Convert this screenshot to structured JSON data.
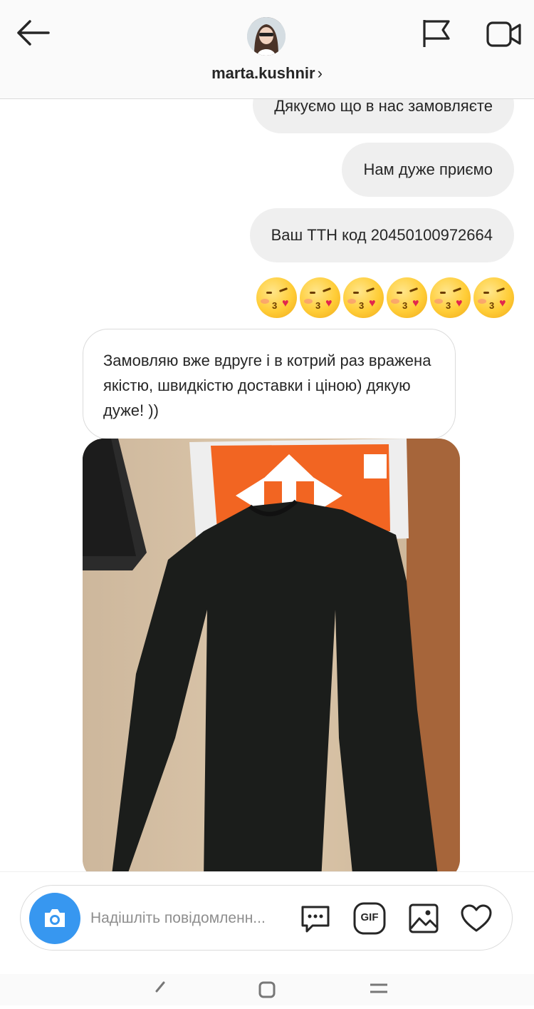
{
  "header": {
    "username": "marta.kushnir",
    "chevron": "›",
    "icons": [
      "back-arrow-icon",
      "flag-icon",
      "video-call-icon"
    ]
  },
  "messages": [
    {
      "side": "right",
      "text": "Дякуємо що в нас замовляєте"
    },
    {
      "side": "right",
      "text": "Нам дуже приємо"
    },
    {
      "side": "right",
      "text": "Ваш ТТН код 20450100972664"
    },
    {
      "side": "right",
      "emoji": "😘",
      "count": 6
    },
    {
      "side": "left",
      "text": "Замовляю вже вдруге і в котрий раз вражена якістю,  швидкістю доставки і ціною)  дякую дуже! ))"
    },
    {
      "side": "left",
      "image": "black-turtleneck-photo"
    }
  ],
  "composer": {
    "placeholder": "Надішліть повідомленн...",
    "icons": [
      "camera-icon",
      "sticker-icon",
      "gif-icon",
      "gallery-icon",
      "heart-icon"
    ],
    "gif_label": "GIF"
  },
  "colors": {
    "accent": "#3797f0",
    "bubble_gray": "#efefef",
    "border": "#dbdbdb"
  }
}
